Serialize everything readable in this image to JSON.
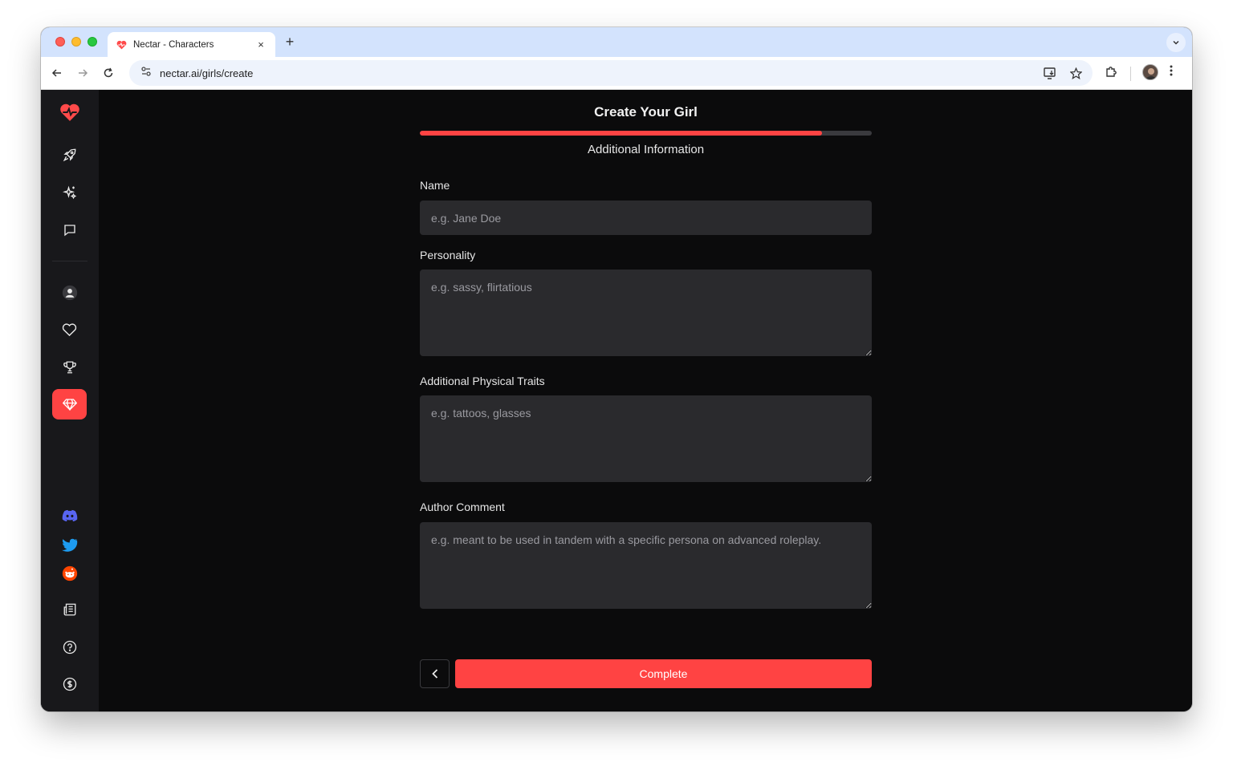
{
  "browser": {
    "tab_title": "Nectar - Characters",
    "tab_close": "×",
    "new_tab": "+",
    "url": "nectar.ai/girls/create"
  },
  "page": {
    "title": "Create Your Girl",
    "progress_fraction": 0.89,
    "step_title": "Additional Information"
  },
  "form": {
    "name": {
      "label": "Name",
      "placeholder": "e.g. Jane Doe",
      "value": ""
    },
    "personality": {
      "label": "Personality",
      "placeholder": "e.g. sassy, flirtatious",
      "value": ""
    },
    "physical_traits": {
      "label": "Additional Physical Traits",
      "placeholder": "e.g. tattoos, glasses",
      "value": ""
    },
    "author_comment": {
      "label": "Author Comment",
      "placeholder": "e.g. meant to be used in tandem with a specific persona on advanced roleplay.",
      "value": ""
    }
  },
  "buttons": {
    "complete": "Complete"
  },
  "colors": {
    "accent": "#ff4343",
    "sidebar_bg": "#18181b",
    "app_bg": "#0b0b0c",
    "field_bg": "#2a2a2d"
  },
  "sidebar_icons": [
    "heart-pulse-logo",
    "rocket-icon",
    "sparkles-icon",
    "chat-icon",
    "user-icon",
    "heart-icon",
    "trophy-icon",
    "gem-icon",
    "discord-icon",
    "twitter-icon",
    "reddit-icon",
    "newspaper-icon",
    "help-icon",
    "dollar-icon"
  ]
}
